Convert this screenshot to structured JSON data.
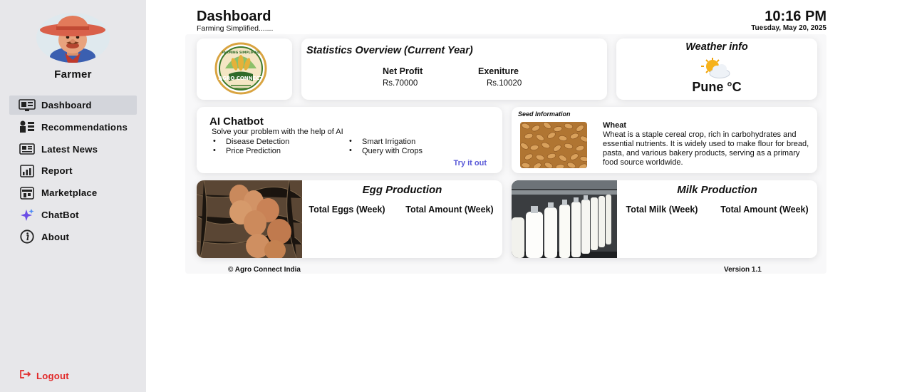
{
  "sidebar": {
    "user_name": "Farmer",
    "items": [
      {
        "label": "Dashboard",
        "icon": "dashboard-icon",
        "active": true
      },
      {
        "label": "Recommendations",
        "icon": "recommendations-icon"
      },
      {
        "label": "Latest News",
        "icon": "news-icon"
      },
      {
        "label": "Report",
        "icon": "report-icon"
      },
      {
        "label": "Marketplace",
        "icon": "marketplace-icon"
      },
      {
        "label": "ChatBot",
        "icon": "sparkle-icon"
      },
      {
        "label": "About",
        "icon": "info-icon"
      }
    ],
    "logout_label": "Logout"
  },
  "header": {
    "title": "Dashboard",
    "subtitle": "Farming Simplified.......",
    "time": "10:16 PM",
    "date": "Tuesday, May 20, 2025"
  },
  "logo": {
    "top_text": "FARMING SIMPLIFIED",
    "banner_text": "AGRO CONNECT"
  },
  "stats": {
    "title": "Statistics Overview (Current Year)",
    "profit_label": "Net Profit",
    "profit_value": "Rs.70000",
    "expense_label": "Exeniture",
    "expense_value": "Rs.10020"
  },
  "weather": {
    "title": "Weather info",
    "city": "Pune °C",
    "icon": "partly-cloudy-icon"
  },
  "chatbot": {
    "title": "AI Chatbot",
    "subtitle": "Solve your problem with the help of AI",
    "features_left": [
      "Disease Detection",
      "Price Prediction"
    ],
    "features_right": [
      "Smart Irrigation",
      "Query with Crops"
    ],
    "cta": "Try it out"
  },
  "seed": {
    "header": "Seed Information",
    "name": "Wheat",
    "description": "Wheat is a staple cereal crop, rich in carbohydrates and essential nutrients. It is widely used to make flour for bread, pasta, and various bakery products, serving as a primary food source worldwide."
  },
  "egg": {
    "title": "Egg Production",
    "label1": "Total Eggs (Week)",
    "label2": "Total Amount (Week)"
  },
  "milk": {
    "title": "Milk Production",
    "label1": "Total Milk (Week)",
    "label2": "Total Amount (Week)"
  },
  "footer": {
    "copyright": "© Agro Connect India",
    "version": "Version 1.1"
  },
  "colors": {
    "sidebar_bg": "#e7e7ea",
    "active_item_bg": "#d3d5db",
    "logout": "#e22a2a",
    "link": "#5a5ad8"
  }
}
